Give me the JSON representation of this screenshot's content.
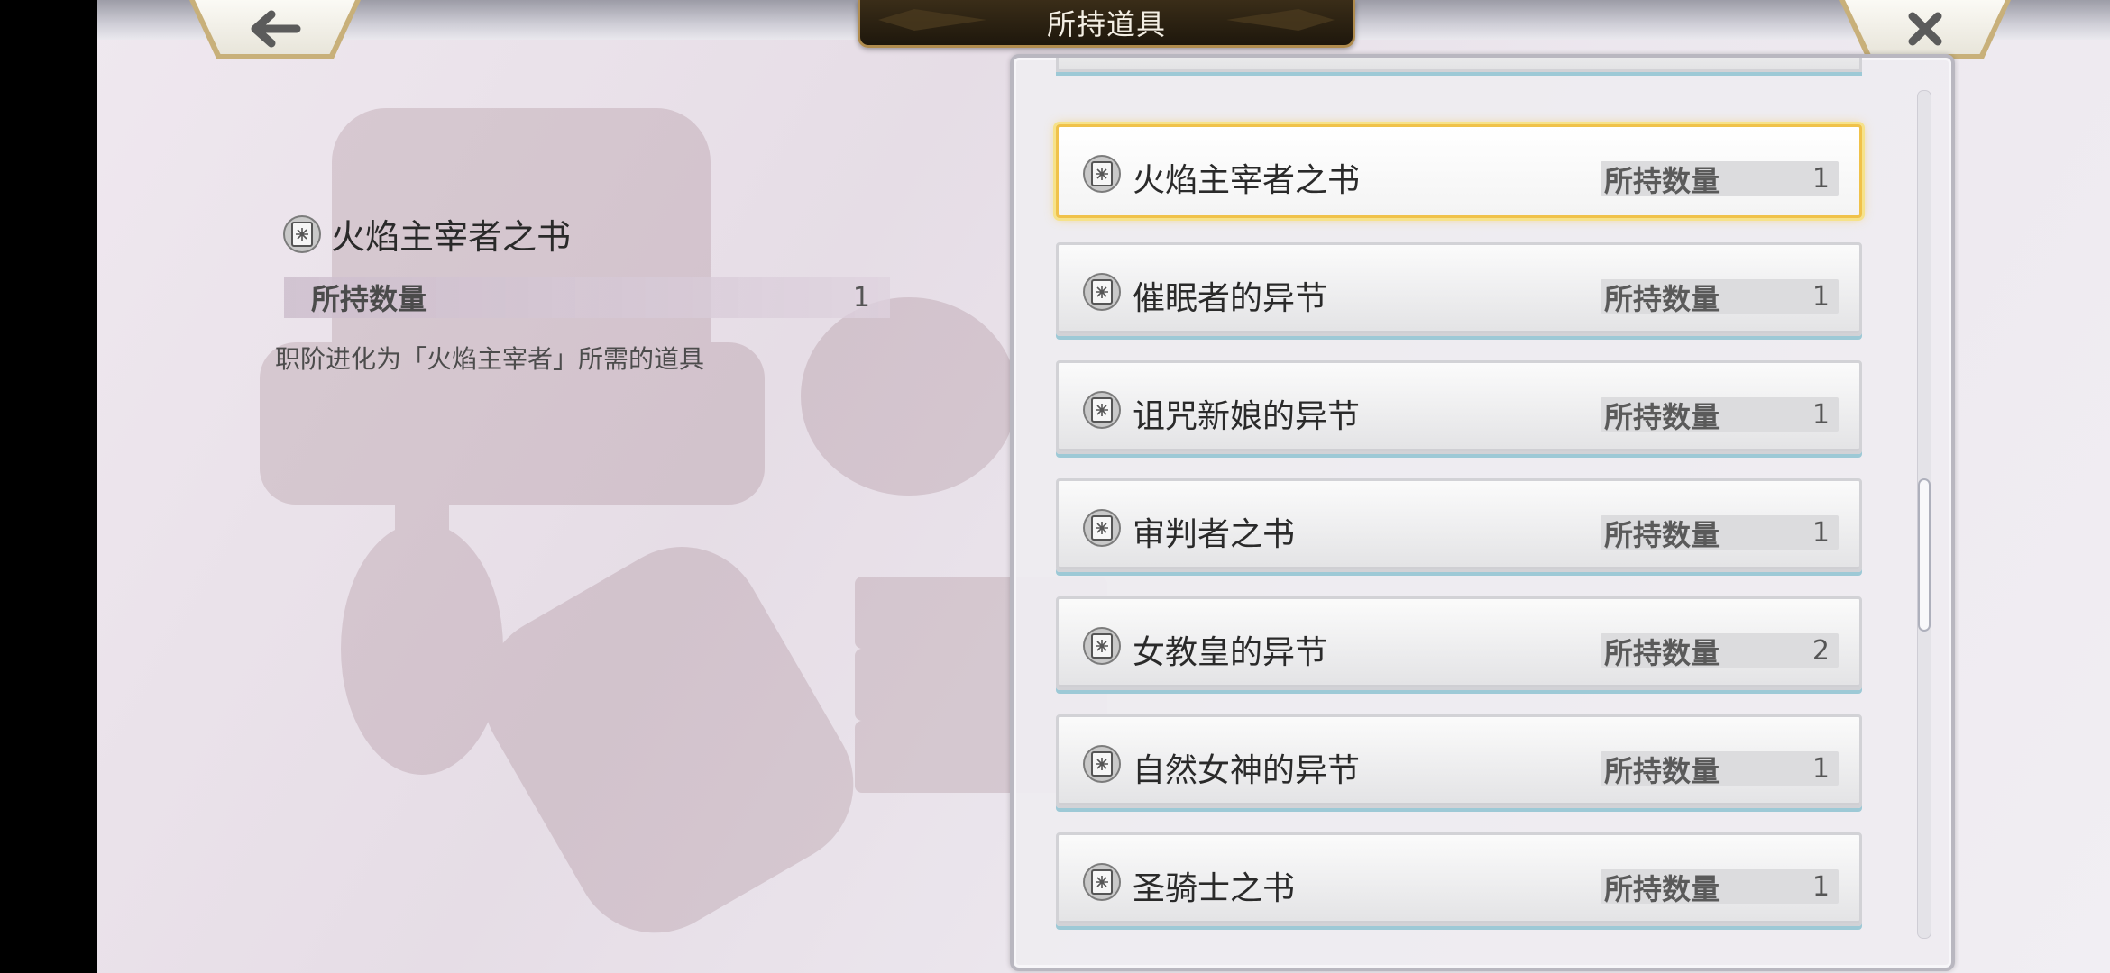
{
  "header": {
    "title": "所持道具",
    "back_icon": "arrow-left-icon",
    "close_icon": "close-icon"
  },
  "detail": {
    "name": "火焰主宰者之书",
    "qty_label": "所持数量",
    "qty_value": "1",
    "description": "职阶进化为「火焰主宰者」所需的道具"
  },
  "items": [
    {
      "name": "火焰主宰者之书",
      "qty_label": "所持数量",
      "qty": "1",
      "selected": true
    },
    {
      "name": "催眠者的异节",
      "qty_label": "所持数量",
      "qty": "1"
    },
    {
      "name": "诅咒新娘的异节",
      "qty_label": "所持数量",
      "qty": "1"
    },
    {
      "name": "审判者之书",
      "qty_label": "所持数量",
      "qty": "1"
    },
    {
      "name": "女教皇的异节",
      "qty_label": "所持数量",
      "qty": "2"
    },
    {
      "name": "自然女神的异节",
      "qty_label": "所持数量",
      "qty": "1"
    },
    {
      "name": "圣骑士之书",
      "qty_label": "所持数量",
      "qty": "1"
    }
  ],
  "colors": {
    "selection": "#f0c24a",
    "title_plate": "#2a2012"
  }
}
